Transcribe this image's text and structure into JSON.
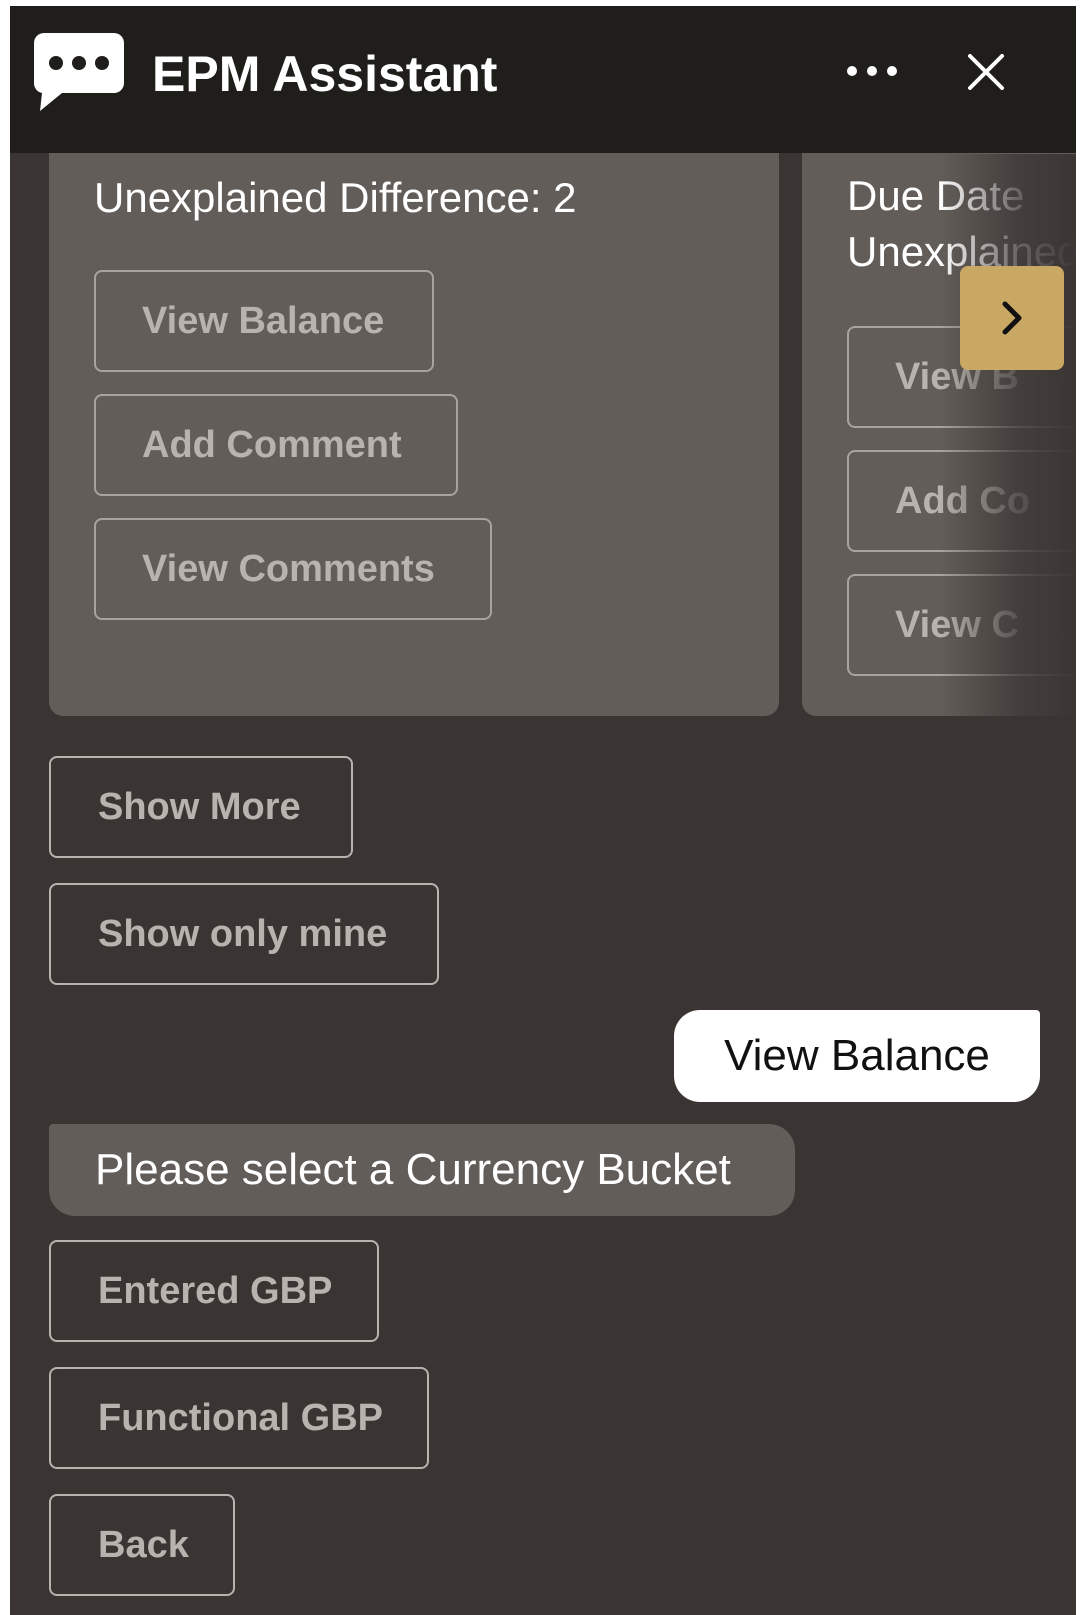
{
  "header": {
    "title": "EPM Assistant",
    "icons": [
      "chat-bubble-icon",
      "more-icon",
      "close-icon"
    ]
  },
  "cards": [
    {
      "lines": [
        "Unexplained Difference: 2"
      ],
      "buttons": [
        "View Balance",
        "Add Comment",
        "View Comments"
      ]
    },
    {
      "lines": [
        "Due Date",
        "Unexplained"
      ],
      "buttons": [
        "View B",
        "Add Co",
        "View C"
      ]
    }
  ],
  "actions": {
    "show_more": "Show More",
    "show_only_mine": "Show only mine"
  },
  "messages": {
    "user": "View Balance",
    "bot": "Please select a Currency Bucket"
  },
  "currency_options": [
    "Entered GBP",
    "Functional GBP",
    "Back"
  ],
  "colors": {
    "header_bg": "#1f1e1a",
    "panel_bg": "#3a3433",
    "card_bg": "#625d58",
    "accent": "#c9a864"
  }
}
